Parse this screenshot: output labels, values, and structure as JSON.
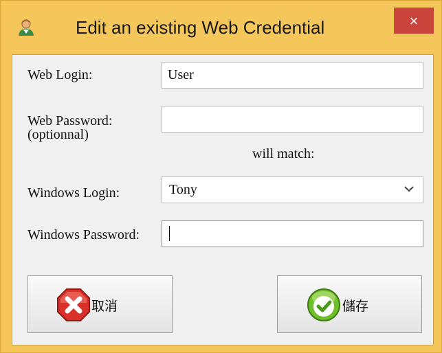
{
  "window": {
    "title": "Edit an existing Web Credential",
    "close_label": "×",
    "app_icon": "user-icon",
    "frame_color": "#f5c75a"
  },
  "form": {
    "web_login_label": "Web Login:",
    "web_login_value": "User",
    "web_password_label_line1": "Web Password:",
    "web_password_label_line2": "(optionnal)",
    "web_password_value": "",
    "will_match_text": "will match:",
    "windows_login_label": "Windows Login:",
    "windows_login_value": "Tony",
    "windows_password_label": "Windows Password:",
    "windows_password_value": ""
  },
  "buttons": {
    "cancel_label": "取消",
    "cancel_icon": "cancel-x-icon",
    "save_label": "儲存",
    "save_icon": "checkmark-icon"
  }
}
